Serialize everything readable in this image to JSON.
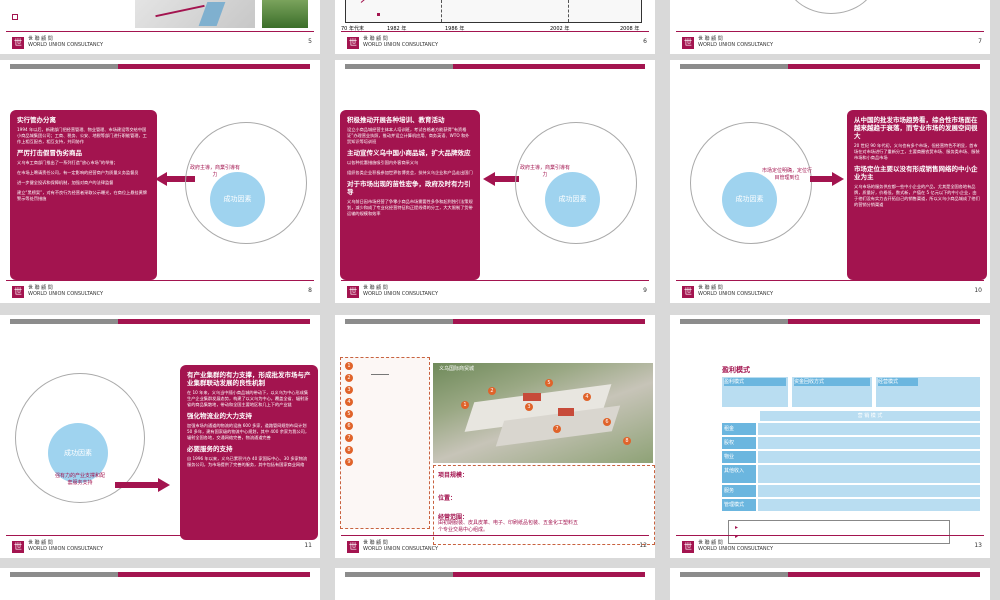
{
  "company": {
    "name_cn": "世 聯 顧 問",
    "name_en": "WORLD UNION CONSULTANCY",
    "logo_char": "世"
  },
  "colors": {
    "brand": "#a3144f",
    "accent_blue": "#9fd3ef",
    "bg": "#d9d9d9"
  },
  "pages": {
    "p5": "5",
    "p6": "6",
    "p7": "7",
    "p8": "8",
    "p9": "9",
    "p10": "10",
    "p11": "11",
    "p12": "12",
    "p13": "13"
  },
  "timeline": {
    "start": "70 年代末",
    "ticks": [
      "1982 年",
      "1986 年",
      "2002 年",
      "2008 年"
    ]
  },
  "core_label": "成功因素",
  "slide8": {
    "side_label": "政府主導，商業引導有力",
    "sections": [
      {
        "h": "实行管办分离",
        "p": "1994 年以后，新建部门把经营管理、物业管理、市场建设等交给中国小商品城集团公司；工商、税务、公安、地税等部门进行职能管理，工作上相互配合，相互支持，共同协作"
      },
      {
        "h": "严厉打击假冒伪劣商品",
        "p": "义乌市工商部门推出了一系列打造“放心市场”的举措；"
      },
      {
        "h": "",
        "p": "在市场上聘请责任公司，有一定影响的经营商户为质量义务监督员"
      },
      {
        "h": "",
        "p": "进一步健全投诉和保障机制，加强对商户的法律监督"
      },
      {
        "h": "",
        "p": "建立“黑榜案”，对有不良行为经营者采取公示曝光，在商位上悬挂黄牌警示等处罚措施"
      }
    ]
  },
  "slide9": {
    "side_label": "政府主導，商業引導有力",
    "sections": [
      {
        "h": "积极推动开展各种培训、教育活动",
        "p": "设立小商品城经营主体本人培训班，考试合格者方能获得“有资格证”办理营业执照，推动并设立计算机应用、商务英语、WTO 和外贸知识等培训班"
      },
      {
        "h": "主动宣传义乌中国小商品城，扩大品牌效应",
        "p": "以各种优惠措施吸引国内外客商采义乌"
      },
      {
        "h": "",
        "p": "组织各类企业积极参加世界各博览会，扶持义乌企业和产品走出国门"
      },
      {
        "h": "对于市场出现的苗性宏争，政府及时有力引导",
        "p": "义乌前日因市场经营了争零小商品市场需要性多争和起到独引法策规划，减少和成了专业化经营特征和正提线得的分工，大大限制了货带运输的规模和效率"
      }
    ]
  },
  "slide10": {
    "side_label": "市场定位明确，定位行目管理到位",
    "sections": [
      {
        "h": "从中国的批发市场趋势看，综合性市场面在越来越趋于衰落，而专业市场的发展空间很大",
        "p": "20 世纪 90 年代初，义乌也有多个市场，但经营特色不明显，首市场在对市场进行了重新分工，主要商圈农贸市场、服务类市场、服装市场和小商品市场"
      },
      {
        "h": "市场定位主要以没有形成销售网络的中小企业为主",
        "p": "义乌市场的服务供应都一些中小企业的产品，尤其是全国各地有品牌，质量好，价格低，数式新，产值在 5 亿元以下的中小企业，由于他们没有实力去开拓自己的销售渠道，所以义乌小商品城成了他们的营销分销渠道"
      }
    ]
  },
  "slide11": {
    "side_label": "强有力的产业支撑和配套服务支持",
    "sections": [
      {
        "h": "有产业集群的有力支撑，形成批发市场与产业集群联动发展的良性机制",
        "p": "在 10 年来，义乌当中随小商品城的带动下，以义乌为中心形成集生产企业集群发展态势，构建了以义乌为中心，覆盖全省、辐射浙省的商品集散地，带动和全国主要地区和几上下的产业链"
      },
      {
        "h": "强化物流业的大力支持",
        "p": "加强市场内通道的物流的设施 600 多家，道路管网规划布局计划 50 多年，建有国家级的物流中心规划，其中 400 余家为我公司，辐射全国各地，交通网络完善，物流通道完善"
      },
      {
        "h": "必要服务的支持",
        "p": "自 1996 年以来，义乌已累积兴办 40 家国际中心、30 多家物流服务公司，为市场提供了完善的服务，其中包括有国家商业网络"
      }
    ]
  },
  "slide12": {
    "list_nums": [
      "1",
      "2",
      "3",
      "4",
      "5",
      "6",
      "7",
      "8",
      "9"
    ],
    "map_title": "义乌国际商贸城",
    "marker_nums": [
      "1",
      "2",
      "3",
      "4",
      "5",
      "6",
      "7",
      "8"
    ],
    "scale_label": "项目规模：",
    "location_label": "位置：",
    "business_label": "经营范围：",
    "business_text": "由初期服装、皮具皮革、电子、印刷纸品包装、五金化工塑料五个专业交易中心组成。"
  },
  "slide13": {
    "title": "盈利模式",
    "col_titles": [
      "盈利模式",
      "资金回收方式",
      "经营模式"
    ],
    "row_labels": [
      "租金",
      "股权",
      "物业",
      "其他收入",
      "服务",
      "管理模式"
    ],
    "center_header": "营 销 模 式",
    "bullets": [
      "",
      ""
    ]
  }
}
